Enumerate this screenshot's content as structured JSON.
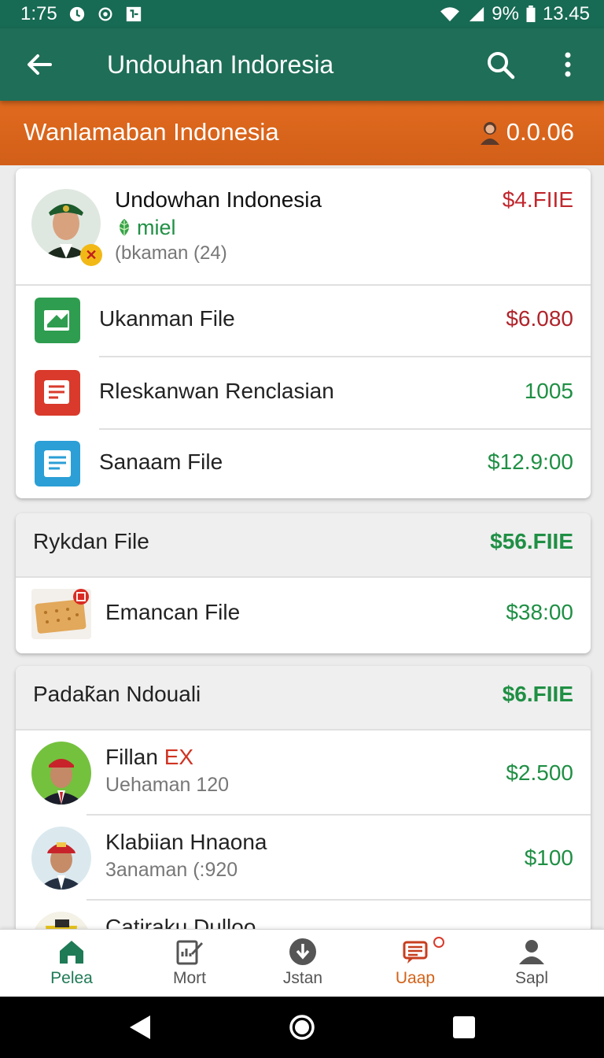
{
  "status_bar": {
    "time": "1:75",
    "battery": "9%",
    "clock": "13.45"
  },
  "app_bar": {
    "title": "Undouhan Indoresia"
  },
  "banner": {
    "title": "Wanlamaban Indonesia",
    "amount": "0.0.06"
  },
  "profile": {
    "name": "Undowhan Indonesia",
    "subtitle": "miel",
    "meta": "(bkaman (24)",
    "amount": "$4.FIIE"
  },
  "files": [
    {
      "label": "Ukanman File",
      "amount": "$6.080",
      "color": "#2e9d4f"
    },
    {
      "label": "Rleskanwan Renclasian",
      "amount": "1005",
      "color": "#d93a2b"
    },
    {
      "label": "Sanaam File",
      "amount": "$12.9:00",
      "color": "#2b9fd6"
    }
  ],
  "section2": {
    "title": "Rykdan File",
    "amount": "$56.FIIE",
    "item_label": "Emancan File",
    "item_amount": "$38:00"
  },
  "section3": {
    "title": "Padak̃an Ndouali",
    "amount": "$6.FIIE",
    "people": [
      {
        "name": "Fillan",
        "name_tag": "EX",
        "meta": "Uehaman 120",
        "amount": "$2.500"
      },
      {
        "name": "Klabiian Hnaona",
        "meta": "3anaman (:920",
        "amount": "$100"
      },
      {
        "name": "Catiraku Dulloo"
      }
    ]
  },
  "nav": [
    {
      "label": "Pelea",
      "icon": "home-icon"
    },
    {
      "label": "Mort",
      "icon": "edit-icon"
    },
    {
      "label": "Jstan",
      "icon": "download-icon"
    },
    {
      "label": "Uaap",
      "icon": "message-icon"
    },
    {
      "label": "Sapl",
      "icon": "profile-icon"
    }
  ],
  "colors": {
    "app_bar": "#1f6e57",
    "banner": "#e06a1f",
    "accent_green": "#1f8f44",
    "accent_red": "#c0262c"
  }
}
